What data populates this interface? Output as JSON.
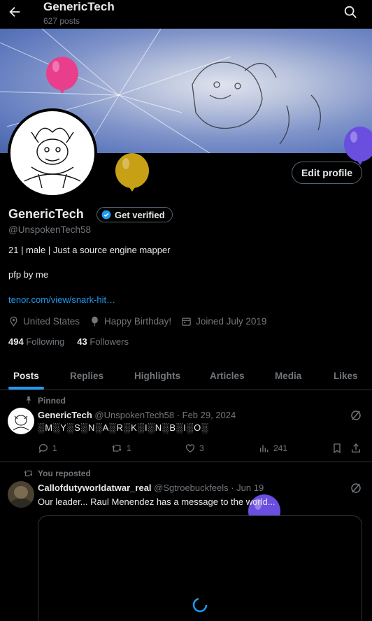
{
  "header": {
    "title": "GenericTech",
    "post_count": "627 posts"
  },
  "profile": {
    "name": "GenericTech",
    "get_verified_label": "Get verified",
    "handle": "@UnspokenTech58",
    "bio": "21 | male | Just a source engine mapper",
    "pfp_note": "pfp by me",
    "link": "tenor.com/view/snark-hit…",
    "location": "United States",
    "birthday": "Happy Birthday!",
    "joined": "Joined July 2019",
    "following_count": "494",
    "following_label": "Following",
    "followers_count": "43",
    "followers_label": "Followers",
    "edit_profile_label": "Edit profile"
  },
  "tabs": [
    {
      "label": "Posts"
    },
    {
      "label": "Replies"
    },
    {
      "label": "Highlights"
    },
    {
      "label": "Articles"
    },
    {
      "label": "Media"
    },
    {
      "label": "Likes"
    }
  ],
  "posts": [
    {
      "context": "Pinned",
      "author": "GenericTech",
      "handle_date": "@UnspokenTech58 · Feb 29, 2024",
      "text": "░M░Y░S░N░A░R░K░I░N░B░I░O░",
      "replies": "1",
      "reposts": "1",
      "likes": "3",
      "views": "241"
    },
    {
      "context": "You reposted",
      "author": "Callofdutyworldatwar_real",
      "handle_date": "@Sgtroebuckfeels · Jun 19",
      "text": "Our leader... Raul Menendez has a message to the world..."
    }
  ],
  "colors": {
    "accent": "#1d9bf0",
    "background": "#000000",
    "muted": "#71767b",
    "border": "#2f3336",
    "balloon_pink": "#e83e8c",
    "balloon_gold": "#c8a016",
    "balloon_purple": "#6a4ee0",
    "balloon_blue": "#1b6fb3"
  },
  "icons": [
    "back-arrow-icon",
    "search-icon",
    "verified-badge-icon",
    "location-icon",
    "balloon-icon",
    "calendar-icon",
    "pin-icon",
    "repost-icon",
    "reply-icon",
    "like-icon",
    "views-icon",
    "bookmark-icon",
    "share-icon",
    "grok-icon",
    "loading-spinner-icon"
  ]
}
